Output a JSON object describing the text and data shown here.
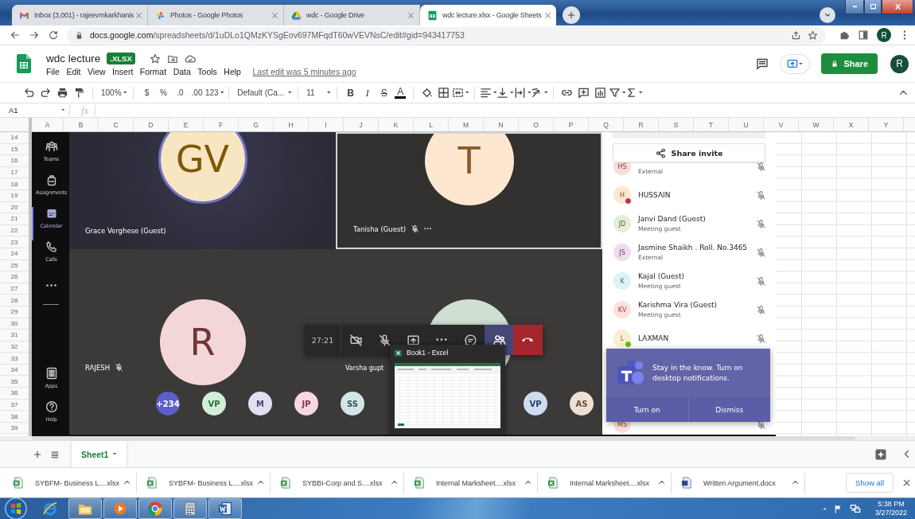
{
  "browser": {
    "tabs": [
      {
        "title": "Inbox (3,001) - rajeevmkarkhanis",
        "kind": "gmail",
        "selected": false
      },
      {
        "title": "Photos - Google Photos",
        "kind": "photos",
        "selected": false
      },
      {
        "title": "wdc - Google Drive",
        "kind": "drive",
        "selected": false
      },
      {
        "title": "wdc lecture.xlsx - Google Sheets",
        "kind": "sheets",
        "selected": true
      }
    ],
    "url": {
      "host": "docs.google.com",
      "path": "/spreadsheets/d/1uDLo1QMzKYSgEov697MFqdT60wVEVNsC/edit#gid=943417753"
    },
    "profile": "R"
  },
  "doc": {
    "title": "wdc lecture",
    "badge": ".XLSX",
    "menu": [
      "File",
      "Edit",
      "View",
      "Insert",
      "Format",
      "Data",
      "Tools",
      "Help"
    ],
    "last_edit": "Last edit was 5 minutes ago",
    "share": "Share",
    "avatar": "R"
  },
  "toolbar": {
    "zoom": "100%",
    "currency": "$",
    "percent": "%",
    "decrease_decimals": ".0",
    "increase_decimals": ".00",
    "number_format": "123",
    "font": "Default (Ca...",
    "font_size": "11",
    "bold": "B",
    "italic": "I",
    "strikethrough": "S",
    "text_color": "A"
  },
  "formula_bar": {
    "cell": "A1",
    "fx": "fx"
  },
  "columns": [
    "A",
    "B",
    "C",
    "D",
    "E",
    "F",
    "G",
    "H",
    "I",
    "J",
    "K",
    "L",
    "M",
    "N",
    "O",
    "P",
    "Q",
    "R",
    "S",
    "T",
    "U",
    "V",
    "W",
    "X",
    "Y"
  ],
  "rows": [
    "14",
    "15",
    "16",
    "17",
    "18",
    "19",
    "20",
    "21",
    "22",
    "23",
    "24",
    "25",
    "26",
    "27",
    "28",
    "29",
    "30",
    "31",
    "32",
    "33",
    "34",
    "35",
    "36",
    "37",
    "38",
    "39"
  ],
  "teams": {
    "rail": [
      {
        "label": "Teams",
        "kind": "teams",
        "selected": false
      },
      {
        "label": "Assignments",
        "kind": "assignments",
        "selected": false
      },
      {
        "label": "Calendar",
        "kind": "calendar",
        "selected": true
      },
      {
        "label": "Calls",
        "kind": "calls",
        "selected": false
      },
      {
        "kind": "more",
        "selected": false
      }
    ],
    "rail_bottom": [
      {
        "label": "Apps",
        "kind": "apps"
      },
      {
        "label": "Help",
        "kind": "help"
      }
    ],
    "tiles": [
      {
        "initials": "GV",
        "name": "Grace Verghese (Guest)",
        "color": "#f8e6c2",
        "muted": false,
        "speaking": true,
        "highlighted": false,
        "show_more": false
      },
      {
        "initials": "T",
        "name": "Tanisha (Guest)",
        "color": "#fde7d1",
        "muted": true,
        "speaking": false,
        "highlighted": true,
        "show_more": true
      },
      {
        "initials": "R",
        "name": "RAJESH",
        "color": "#f3d6d8",
        "muted": true,
        "speaking": false,
        "highlighted": false,
        "show_more": false
      },
      {
        "name": "Varsha gupt",
        "color": "#cfe0d3",
        "muted": false,
        "speaking": false,
        "highlighted": false,
        "show_more": false
      }
    ],
    "strip": {
      "left": [
        {
          "initials": "+234",
          "color": "#5b5fc7"
        },
        {
          "initials": "VP",
          "color": "#d3efdc"
        },
        {
          "initials": "M",
          "color": "#e4def3"
        },
        {
          "initials": "JP",
          "color": "#f8d6e4"
        },
        {
          "initials": "SS",
          "color": "#d5e5e7"
        }
      ],
      "right": [
        {
          "initials": "VP",
          "color": "#cedcf0"
        },
        {
          "initials": "AS",
          "color": "#efe0d5"
        }
      ]
    },
    "call": {
      "timer": "27:21",
      "controls": [
        {
          "kind": "camera",
          "selected": false
        },
        {
          "kind": "mic",
          "selected": false
        },
        {
          "kind": "share",
          "selected": false
        },
        {
          "kind": "more",
          "selected": false
        },
        {
          "kind": "chat",
          "selected": false
        },
        {
          "kind": "people",
          "selected": true
        },
        {
          "kind": "hangup",
          "selected": false
        }
      ]
    },
    "preview": {
      "title": "Book1 - Excel"
    },
    "panel": {
      "share_invite": "Share invite",
      "people": [
        {
          "initials": "HS",
          "subtitle": "External",
          "color": "#f7dcdc"
        },
        {
          "initials": "H",
          "name": "HUSSAIN",
          "color": "#fbe7d3",
          "status": {
            "color": "#c4314b"
          }
        },
        {
          "initials": "JD",
          "name": "Janvi Dand (Guest)",
          "subtitle": "Meeting guest",
          "color": "#e3eedb"
        },
        {
          "initials": "JS",
          "name": "Jasmine Shaikh . Roll. No.3465",
          "subtitle": "External",
          "color": "#f0dcef"
        },
        {
          "initials": "K",
          "name": "Kajal (Guest)",
          "subtitle": "Meeting guest",
          "color": "#dcf2f3"
        },
        {
          "initials": "KV",
          "name": "Karishma Vira (Guest)",
          "subtitle": "Meeting guest",
          "color": "#fde0dc"
        },
        {
          "initials": "L",
          "name": "LAXMAN",
          "color": "#fcefcf",
          "status": {
            "color": "#6bb700"
          }
        }
      ],
      "last_person": {
        "initials": "MS",
        "color": "#fde0dc"
      }
    },
    "notification": {
      "text": "Stay in the know. Turn on desktop notifications.",
      "actions": [
        "Turn on",
        "Dismiss"
      ]
    }
  },
  "sheet_tabs": [
    {
      "label": "Sheet1",
      "selected": true
    }
  ],
  "downloads": [
    {
      "name": "SYBFM- Business L....xlsx",
      "kind": "xlsx"
    },
    {
      "name": "SYBFM- Business L....xlsx",
      "kind": "xlsx"
    },
    {
      "name": "SYBBI-Corp and S....xlsx",
      "kind": "xlsx"
    },
    {
      "name": "Internal Marksheet....xlsx",
      "kind": "xlsx"
    },
    {
      "name": "Internal Marksheet....xlsx",
      "kind": "xlsx"
    },
    {
      "name": "Written Argument.docx",
      "kind": "docx"
    }
  ],
  "show_all": "Show all",
  "taskbar": {
    "apps": [
      {
        "kind": "ie",
        "open": false
      },
      {
        "kind": "explorer",
        "open": true
      },
      {
        "kind": "media",
        "open": true
      },
      {
        "kind": "chrome",
        "open": true
      },
      {
        "kind": "calculator",
        "open": true
      },
      {
        "kind": "word",
        "open": true
      }
    ],
    "time": "5:38 PM",
    "date": "3/27/2022"
  }
}
